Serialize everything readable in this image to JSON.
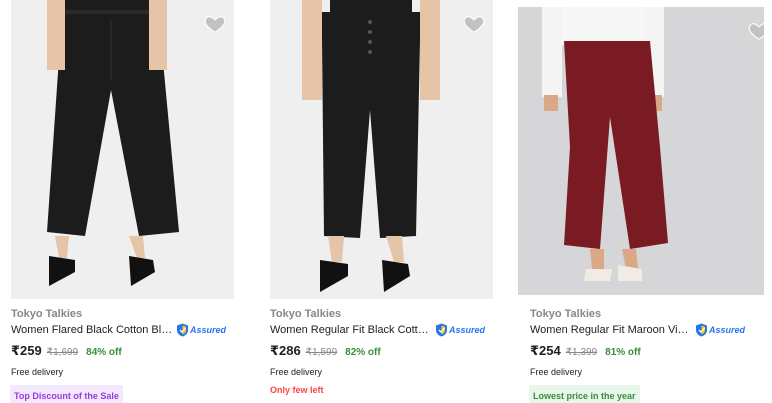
{
  "products": [
    {
      "brand": "Tokyo Talkies",
      "title": "Women Flared Black Cotton Blen...",
      "assured_label": "Assured",
      "price": "₹259",
      "mrp": "₹1,699",
      "discount": "84% off",
      "delivery": "Free delivery",
      "tag": "Top Discount of the Sale",
      "tag_style": "purple",
      "garment_color": "#1c1c1c",
      "wishlist_icon": "heart-icon"
    },
    {
      "brand": "Tokyo Talkies",
      "title": "Women Regular Fit Black Cotton ...",
      "assured_label": "Assured",
      "price": "₹286",
      "mrp": "₹1,599",
      "discount": "82% off",
      "delivery": "Free delivery",
      "tag": "Only few left",
      "tag_style": "red",
      "garment_color": "#1c1c1c",
      "wishlist_icon": "heart-icon"
    },
    {
      "brand": "Tokyo Talkies",
      "title": "Women Regular Fit Maroon Visc...",
      "assured_label": "Assured",
      "price": "₹254",
      "mrp": "₹1,399",
      "discount": "81% off",
      "delivery": "Free delivery",
      "tag": "Lowest price in the year",
      "tag_style": "green",
      "garment_color": "#7a1a22",
      "wishlist_icon": "heart-icon"
    }
  ],
  "colors": {
    "accent": "#2874f0",
    "discount_green": "#388e3c",
    "muted_text": "#878787",
    "few_left_red": "#ff4343",
    "top_discount_purple": "#9b3bd7"
  }
}
